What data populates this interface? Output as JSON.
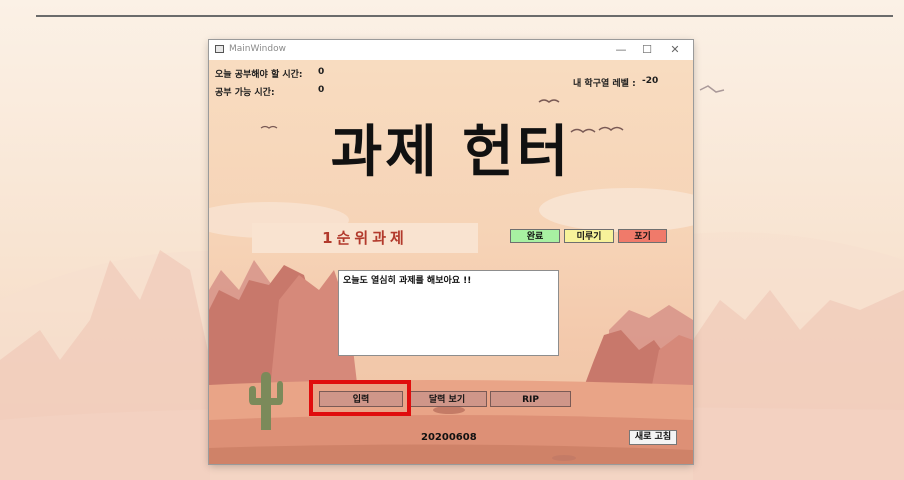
{
  "window": {
    "title": "MainWindow",
    "minimize_symbol": "—",
    "maximize_symbol": "☐",
    "close_symbol": "✕"
  },
  "stats": {
    "study_needed_label": "오늘 공부해야 할 시간:",
    "study_needed_value": "0",
    "study_available_label": "공부 가능 시간:",
    "study_available_value": "0",
    "level_label": "내 학구열 레벨 :",
    "level_value": "-20"
  },
  "app_title": "과제 헌터",
  "priority_task": "1순위과제",
  "task_buttons": {
    "done": "완료",
    "postpone": "미루기",
    "giveup": "포기"
  },
  "message_box": {
    "text": "오늘도 열심히 과제를 해보아요 !!"
  },
  "bottom_buttons": {
    "input": "입력",
    "calendar": "달력 보기",
    "rip": "RIP"
  },
  "date": "20200608",
  "refresh_label": "새로 고침",
  "colors": {
    "done_btn": "#a8f0a2",
    "postpone_btn": "#f7f29a",
    "giveup_btn": "#f07a6a",
    "highlight": "#e00d0d",
    "priority_text": "#b23a2c"
  }
}
